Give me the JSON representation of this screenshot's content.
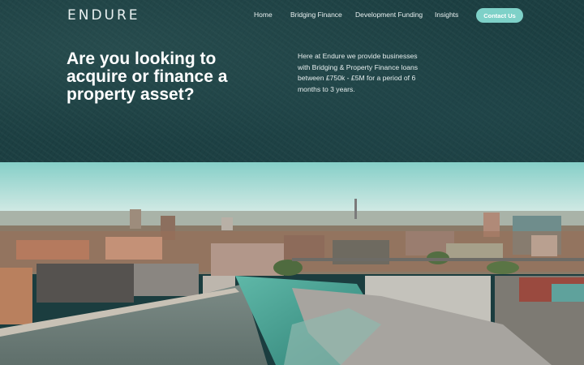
{
  "brand": {
    "logo_text": "ENDURE"
  },
  "nav": {
    "items": [
      {
        "label": "Home"
      },
      {
        "label": "Bridging Finance"
      },
      {
        "label": "Development Funding"
      },
      {
        "label": "Insights"
      }
    ],
    "contact_label": "Contact Us"
  },
  "hero": {
    "headline": "Are you looking to acquire or finance a property asset?",
    "blurb": "Here at Endure we provide businesses with Bridging & Property Finance loans between £750k - £5M for a period of 6 months to 3 years."
  },
  "colors": {
    "hero_bg": "#1c3f42",
    "accent_button": "#7ed1c8",
    "text_light": "#ffffff"
  }
}
